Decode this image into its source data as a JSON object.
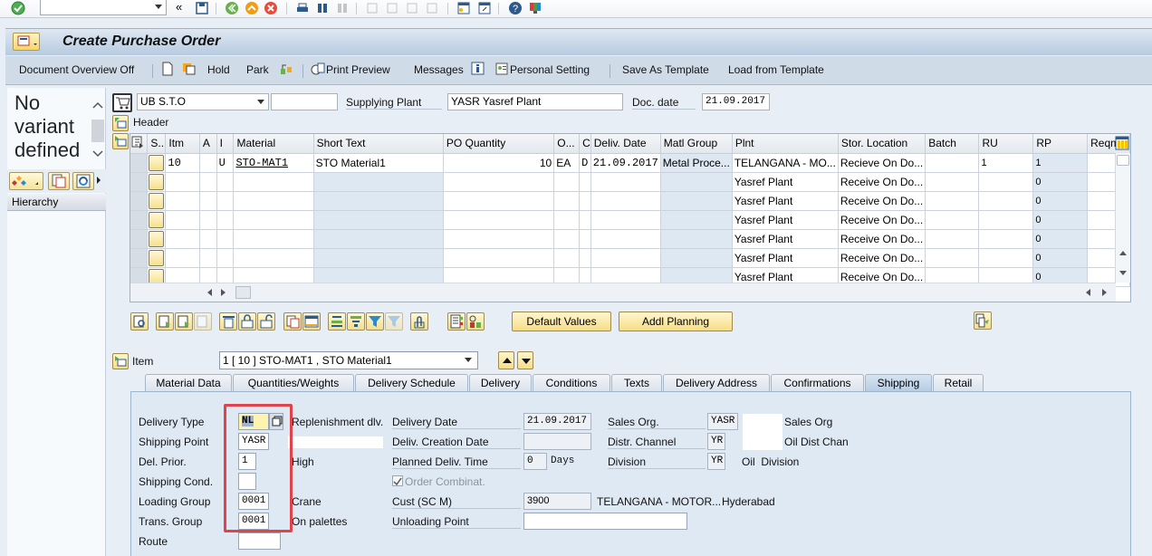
{
  "system_toolbar": {
    "command_field": {
      "value": "",
      "placeholder": ""
    },
    "icons": [
      "enter-icon",
      "back-double-arrow-icon",
      "save-icon",
      "back-icon",
      "exit-icon",
      "cancel-icon",
      "print-icon",
      "find-icon",
      "find-next-icon",
      "first-page-icon",
      "previous-page-icon",
      "next-page-icon",
      "last-page-icon",
      "new-session-icon",
      "shortcut-icon",
      "help-icon",
      "customize-layout-icon"
    ]
  },
  "title_bar": {
    "title": "Create Purchase Order"
  },
  "app_toolbar": {
    "document_overview": "Document Overview Off",
    "hold": "Hold",
    "park": "Park",
    "print_preview": "Print Preview",
    "messages": "Messages",
    "personal_setting": "Personal Setting",
    "save_as_template": "Save As Template",
    "load_from_template": "Load from Template"
  },
  "left_panel": {
    "no_variant": [
      "No",
      "variant",
      "defined"
    ],
    "hierarchy": "Hierarchy"
  },
  "header": {
    "order_type": "UB S.T.O",
    "po_number": "",
    "supplying_plant_label": "Supplying Plant",
    "supplying_plant": "YASR Yasref Plant",
    "doc_date_label": "Doc. date",
    "doc_date": "21.09.2017",
    "header_label": "Header"
  },
  "grid": {
    "columns": [
      "S..",
      "Itm",
      "A",
      "I",
      "Material",
      "Short Text",
      "PO Quantity",
      "O...",
      "C",
      "Deliv. Date",
      "Matl Group",
      "Plnt",
      "Stor. Location",
      "Batch",
      "RU",
      "RP",
      "Reqmt"
    ],
    "rows": [
      [
        "",
        "10",
        "",
        "U",
        "STO-MAT1",
        "STO Material1",
        "10",
        "EA",
        "D",
        "21.09.2017",
        "Metal Proce...",
        "TELANGANA - MO...",
        "Recieve On Do...",
        "",
        "1",
        "1",
        ""
      ],
      [
        "",
        "",
        "",
        "",
        "",
        "",
        "",
        "",
        "",
        "",
        "",
        "Yasref Plant",
        "Receive On Do...",
        "",
        "",
        "0",
        ""
      ],
      [
        "",
        "",
        "",
        "",
        "",
        "",
        "",
        "",
        "",
        "",
        "",
        "Yasref Plant",
        "Receive On Do...",
        "",
        "",
        "0",
        ""
      ],
      [
        "",
        "",
        "",
        "",
        "",
        "",
        "",
        "",
        "",
        "",
        "",
        "Yasref Plant",
        "Receive On Do...",
        "",
        "",
        "0",
        ""
      ],
      [
        "",
        "",
        "",
        "",
        "",
        "",
        "",
        "",
        "",
        "",
        "",
        "Yasref Plant",
        "Receive On Do...",
        "",
        "",
        "0",
        ""
      ],
      [
        "",
        "",
        "",
        "",
        "",
        "",
        "",
        "",
        "",
        "",
        "",
        "Yasref Plant",
        "Receive On Do...",
        "",
        "",
        "0",
        ""
      ],
      [
        "",
        "",
        "",
        "",
        "",
        "",
        "",
        "",
        "",
        "",
        "",
        "Yasref Plant",
        "Receive On Do...",
        "",
        "",
        "0",
        ""
      ]
    ]
  },
  "grid_toolbar": {
    "default_values": "Default Values",
    "addl_planning": "Addl Planning"
  },
  "item": {
    "label": "Item",
    "selected": "1 [ 10 ] STO-MAT1 , STO Material1"
  },
  "tabs": [
    {
      "label": "Material Data",
      "active": false
    },
    {
      "label": "Quantities/Weights",
      "active": false
    },
    {
      "label": "Delivery Schedule",
      "active": false
    },
    {
      "label": "Delivery",
      "active": false
    },
    {
      "label": "Conditions",
      "active": false
    },
    {
      "label": "Texts",
      "active": false
    },
    {
      "label": "Delivery Address",
      "active": false
    },
    {
      "label": "Confirmations",
      "active": false
    },
    {
      "label": "Shipping",
      "active": true
    },
    {
      "label": "Retail",
      "active": false
    }
  ],
  "shipping": {
    "delivery_type": {
      "label": "Delivery Type",
      "value": "NL",
      "desc": "Replenishment dlv."
    },
    "shipping_point": {
      "label": "Shipping Point",
      "value": "YASR",
      "desc": ""
    },
    "del_prior": {
      "label": "Del. Prior.",
      "value": "1",
      "desc": "High"
    },
    "shipping_cond": {
      "label": "Shipping Cond.",
      "value": ""
    },
    "loading_group": {
      "label": "Loading Group",
      "value": "0001",
      "desc": "Crane"
    },
    "trans_group": {
      "label": "Trans. Group",
      "value": "0001",
      "desc": "On palettes"
    },
    "route": {
      "label": "Route",
      "value": ""
    },
    "delivery_date": {
      "label": "Delivery Date",
      "value": "21.09.2017"
    },
    "deliv_creation_date": {
      "label": "Deliv. Creation Date",
      "value": ""
    },
    "planned_deliv_time": {
      "label": "Planned Deliv. Time",
      "value": "0",
      "unit": "Days"
    },
    "order_combinat": {
      "label": "Order Combinat.",
      "checked": true
    },
    "cust_sc_m": {
      "label": "Cust (SC M)",
      "value": "3900",
      "name": "TELANGANA - MOTOR...",
      "city": "Hyderabad"
    },
    "unloading_point": {
      "label": "Unloading Point",
      "value": ""
    },
    "sales_org": {
      "label": "Sales Org.",
      "value": "YASR",
      "desc": "Sales Org"
    },
    "distr_channel": {
      "label": "Distr. Channel",
      "value": "YR",
      "desc": "Oil Dist Chan"
    },
    "division": {
      "label": "Division",
      "value": "YR",
      "desc": "Oil  Division"
    }
  },
  "colors": {
    "accent_highlight": "#e0434a",
    "button_yellow": "#f6dd85",
    "panel_blue": "#dfe9f4"
  }
}
